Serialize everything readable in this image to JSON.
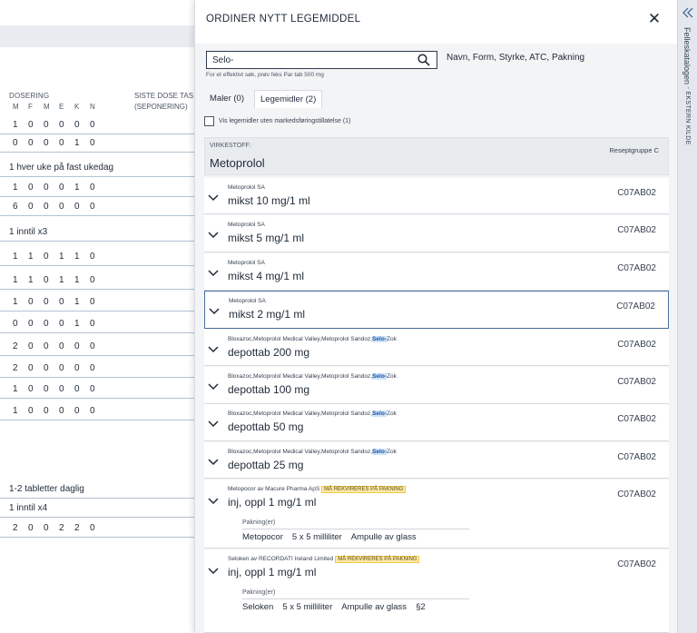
{
  "background_table": {
    "header_dosering": "DOSERING",
    "header_siste_dose": "SISTE DOSE TAS",
    "header_seponering": "(SEPONERING)",
    "day_columns": [
      "M",
      "F",
      "M",
      "E",
      "K",
      "N"
    ],
    "rows": [
      {
        "type": "numbers",
        "values": [
          "1",
          "0",
          "0",
          "0",
          "0",
          "0"
        ]
      },
      {
        "type": "numbers",
        "values": [
          "0",
          "0",
          "0",
          "0",
          "1",
          "0"
        ]
      },
      {
        "type": "text",
        "text": "1 hver uke på fast ukedag"
      },
      {
        "type": "numbers",
        "values": [
          "1",
          "0",
          "0",
          "0",
          "1",
          "0"
        ]
      },
      {
        "type": "numbers",
        "values": [
          "6",
          "0",
          "0",
          "0",
          "0",
          "0"
        ]
      },
      {
        "type": "text",
        "text": "1 inntil x3"
      },
      {
        "type": "numbers",
        "values": [
          "1",
          "1",
          "0",
          "1",
          "1",
          "0"
        ]
      },
      {
        "type": "numbers",
        "values": [
          "1",
          "1",
          "0",
          "1",
          "1",
          "0"
        ]
      },
      {
        "type": "numbers",
        "values": [
          "1",
          "0",
          "0",
          "0",
          "1",
          "0"
        ]
      },
      {
        "type": "numbers",
        "values": [
          "0",
          "0",
          "0",
          "0",
          "1",
          "0"
        ]
      },
      {
        "type": "numbers",
        "values": [
          "2",
          "0",
          "0",
          "0",
          "0",
          "0"
        ]
      },
      {
        "type": "numbers",
        "values": [
          "2",
          "0",
          "0",
          "0",
          "0",
          "0"
        ]
      },
      {
        "type": "numbers",
        "values": [
          "1",
          "0",
          "0",
          "0",
          "0",
          "0"
        ]
      },
      {
        "type": "numbers",
        "values": [
          "1",
          "0",
          "0",
          "0",
          "0",
          "0"
        ]
      },
      {
        "type": "text",
        "text": "1-2 tabletter daglig"
      },
      {
        "type": "text",
        "text": "1 inntil x4"
      },
      {
        "type": "numbers",
        "values": [
          "2",
          "0",
          "0",
          "2",
          "2",
          "0"
        ]
      }
    ]
  },
  "modal": {
    "title": "ORDINER NYTT LEGEMIDDEL",
    "close_icon": "close-icon",
    "search": {
      "value": "Selo-",
      "help": "Navn, Form, Styrke, ATC, Pakning",
      "tip": "For et effektivt søk, prøv feks Par tab 500 mg"
    },
    "tabs": [
      {
        "label": "Maler (0)",
        "active": false
      },
      {
        "label": "Legemidler (2)",
        "active": true
      }
    ],
    "checkbox_label": "Vis legemidler uten markedsføringstillatelse (1)",
    "substance": {
      "label": "VIRKESTOFF:",
      "name": "Metoprolol",
      "reseptgruppe": "Reseptgruppe C"
    },
    "items": [
      {
        "sub": "Metoprolol SA",
        "main": "mikst 10 mg/1 ml",
        "atc": "C07AB02"
      },
      {
        "sub": "Metoprolol SA",
        "main": "mikst 5 mg/1 ml",
        "atc": "C07AB02"
      },
      {
        "sub": "Metoprolol SA",
        "main": "mikst 4 mg/1 ml",
        "atc": "C07AB02"
      },
      {
        "sub": "Metoprolol SA",
        "main": "mikst 2 mg/1 ml",
        "atc": "C07AB02"
      },
      {
        "sub_pre": "Bloxazoc,Metoprolol Medical Valley,Metoprolol Sandoz,",
        "sub_hl": "Selo-",
        "sub_post": "Zok",
        "main": "depottab 200 mg",
        "atc": "C07AB02"
      },
      {
        "sub_pre": "Bloxazoc,Metoprolol Medical Valley,Metoprolol Sandoz,",
        "sub_hl": "Selo-",
        "sub_post": "Zok",
        "main": "depottab 100 mg",
        "atc": "C07AB02"
      },
      {
        "sub_pre": "Bloxazoc,Metoprolol Medical Valley,Metoprolol Sandoz,",
        "sub_hl": "Selo-",
        "sub_post": "Zok",
        "main": "depottab 50 mg",
        "atc": "C07AB02"
      },
      {
        "sub_pre": "Bloxazoc,Metoprolol Medical Valley,Metoprolol Sandoz,",
        "sub_hl": "Selo-",
        "sub_post": "Zok",
        "main": "depottab 25 mg",
        "atc": "C07AB02"
      },
      {
        "sub": "Metopocor av Macure Pharma ApS",
        "badge": "MÅ REKVIRERES PÅ PAKNING",
        "main": "inj, oppl 1 mg/1 ml",
        "atc": "C07AB02",
        "pakning_label": "Pakning(er)",
        "pakning": [
          "Metopocor",
          "5 x 5 milliliter",
          "Ampulle av glass"
        ]
      },
      {
        "sub": "Seloken av RECORDATI Ireland Limited",
        "badge": "MÅ REKVIRERES PÅ PAKNING",
        "main": "inj, oppl 1 mg/1 ml",
        "atc": "C07AB02",
        "pakning_label": "Pakning(er)",
        "pakning": [
          "Seloken",
          "5 x 5 milliliter",
          "Ampulle av glass",
          "§2"
        ]
      }
    ]
  },
  "sidebar": {
    "collapse_icon": "double-chevron-left-icon",
    "label": "Felleskatalogen",
    "label_suffix": "- EKSTERN KILDE"
  },
  "colors": {
    "highlight": "#cfe3f7",
    "warning_badge": "#fde9a8",
    "selected_border": "#4b6fa0"
  }
}
